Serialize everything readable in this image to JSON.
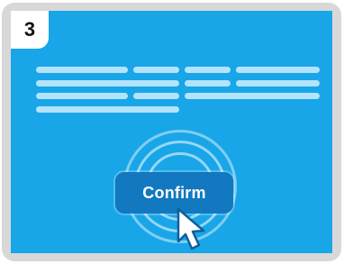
{
  "step": {
    "number": "3"
  },
  "dialog": {
    "confirm_label": "Confirm"
  },
  "colors": {
    "frame": "#d8d8d8",
    "screen": "#18a6e8",
    "placeholder_text": "#b3e4fb",
    "button": "#1278bf",
    "button_text": "#ffffff"
  },
  "icons": {
    "cursor": "mouse-pointer-icon",
    "click_effect": "click-ripple-icon"
  }
}
